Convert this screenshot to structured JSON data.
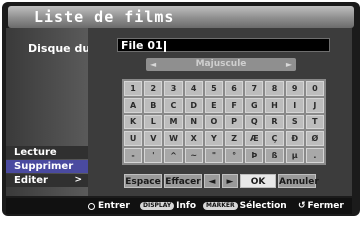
{
  "header": {
    "title": "Liste de films"
  },
  "left": {
    "device_label": "Disque dur",
    "menu": [
      {
        "label": "Lecture",
        "selected": false
      },
      {
        "label": "Supprimer",
        "selected": true
      },
      {
        "label": "Editer",
        "selected": false,
        "arrow": ">"
      }
    ]
  },
  "input": {
    "value": "File 01"
  },
  "case": {
    "label": "Majuscule",
    "left_arrow": "◄",
    "right_arrow": "►"
  },
  "keyboard": {
    "rows": [
      [
        "1",
        "2",
        "3",
        "4",
        "5",
        "6",
        "7",
        "8",
        "9",
        "0"
      ],
      [
        "A",
        "B",
        "C",
        "D",
        "E",
        "F",
        "G",
        "H",
        "I",
        "J"
      ],
      [
        "K",
        "L",
        "M",
        "N",
        "O",
        "P",
        "Q",
        "R",
        "S",
        "T"
      ],
      [
        "U",
        "V",
        "W",
        "X",
        "Y",
        "Z",
        "Æ",
        "Ç",
        "Ð",
        "Ø"
      ],
      [
        "-",
        "'",
        "^",
        "~",
        "\"",
        "°",
        "Þ",
        "ß",
        "µ",
        "."
      ]
    ]
  },
  "actions": {
    "space": "Espace",
    "clear": "Effacer",
    "left": "◄",
    "right": "►",
    "ok": "OK",
    "cancel": "Annuler"
  },
  "footer": {
    "enter": "Entrer",
    "display_key": "DISPLAY",
    "info": "Info",
    "marker_key": "MARKER",
    "selection": "Sélection",
    "close": "Fermer"
  }
}
